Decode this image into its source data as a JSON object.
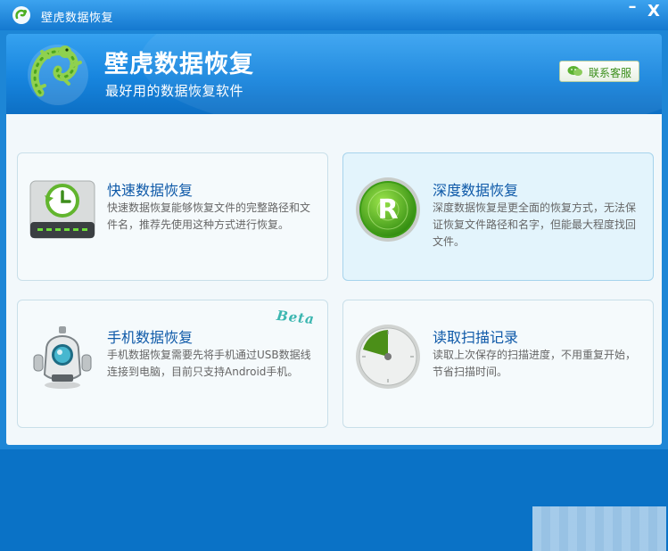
{
  "window": {
    "title": "壁虎数据恢复",
    "minimize_label": "–",
    "close_label": "X"
  },
  "header": {
    "app_name": "壁虎数据恢复",
    "slogan": "最好用的数据恢复软件",
    "customer_service_label": "联系客服"
  },
  "cards": [
    {
      "title": "快速数据恢复",
      "description": "快速数据恢复能够恢复文件的完整路径和文件名，推荐先使用这种方式进行恢复。",
      "icon": "hard-drive-clock-icon"
    },
    {
      "title": "深度数据恢复",
      "description": "深度数据恢复是更全面的恢复方式，无法保证恢复文件路径和名字，但能最大程度找回文件。",
      "icon": "radar-r-icon"
    },
    {
      "title": "手机数据恢复",
      "description": "手机数据恢复需要先将手机通过USB数据线连接到电脑，目前只支持Android手机。",
      "icon": "robot-icon",
      "badge": "Beta"
    },
    {
      "title": "读取扫描记录",
      "description": "读取上次保存的扫描进度，不用重复开始，节省扫描时间。",
      "icon": "dial-gauge-icon"
    }
  ],
  "colors": {
    "titlebar": "#1478cf",
    "header": "#1785de",
    "card_title": "#0e59a8",
    "accent_green": "#3a8e1a"
  }
}
